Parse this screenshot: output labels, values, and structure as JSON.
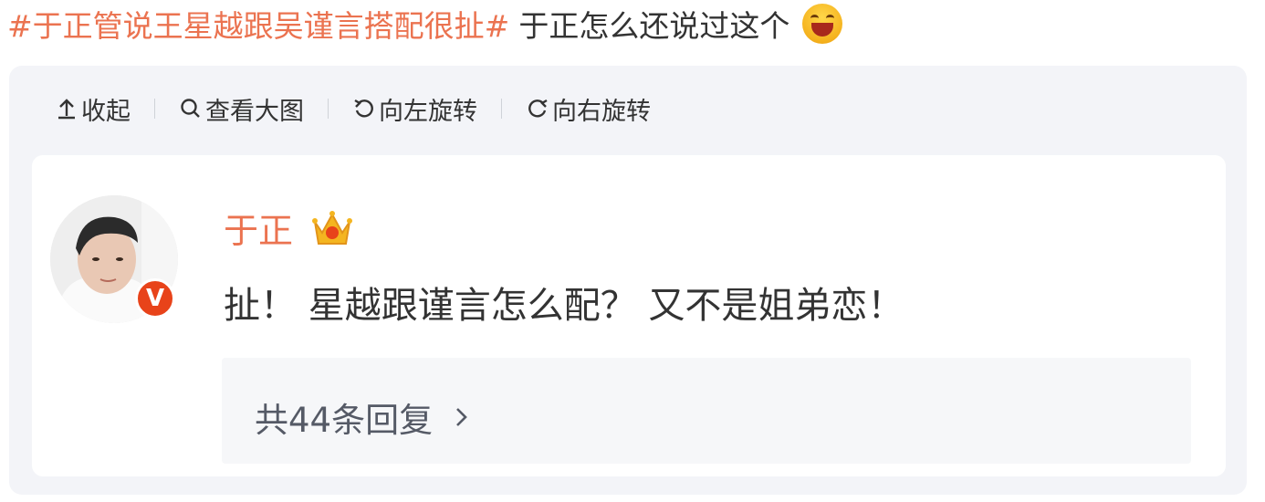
{
  "post": {
    "hashtag": "#于正管说王星越跟吴谨言搭配很扯#",
    "text": "于正怎么还说过这个",
    "emoji": "laughing-emoji"
  },
  "toolbar": {
    "collapse": "收起",
    "view_large": "查看大图",
    "rotate_left": "向左旋转",
    "rotate_right": "向右旋转"
  },
  "comment": {
    "username": "于正",
    "verified_badge": "V",
    "text": "扯！ 星越跟谨言怎么配？ 又不是姐弟恋！",
    "replies_label": "共44条回复"
  },
  "colors": {
    "hashtag": "#eb7350",
    "username": "#eb7350",
    "badge": "#e8431a",
    "card_bg": "#f3f4f8"
  }
}
